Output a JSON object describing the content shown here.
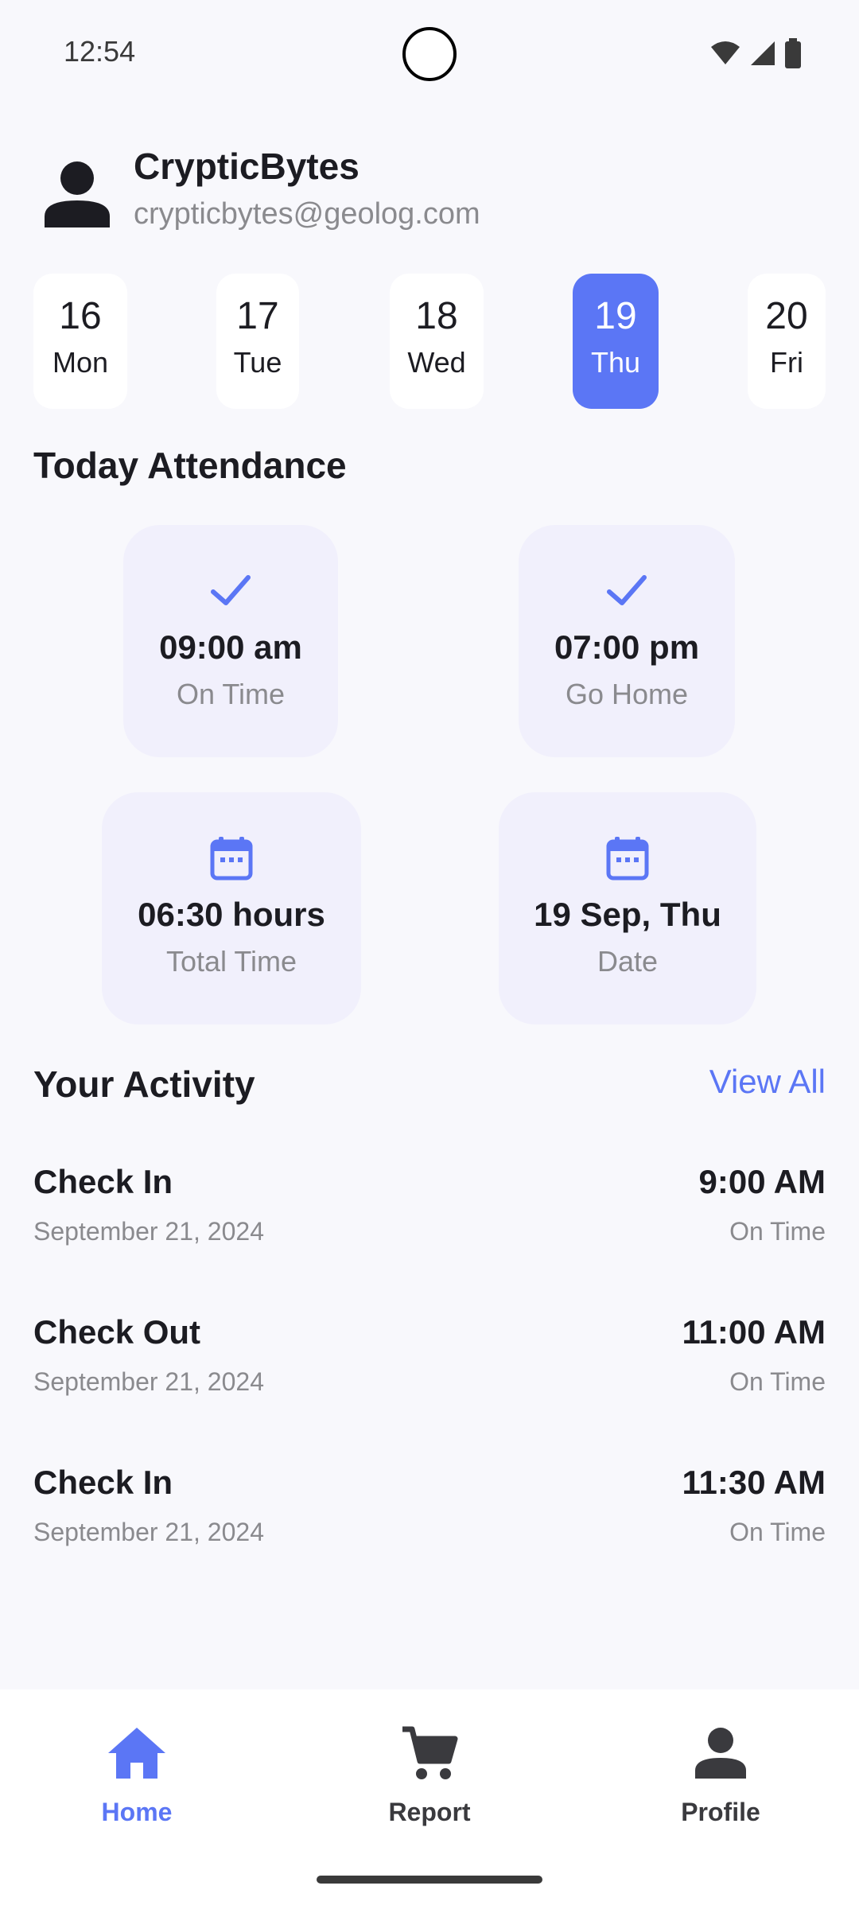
{
  "status_bar": {
    "time": "12:54"
  },
  "profile": {
    "name": "CrypticBytes",
    "email": "crypticbytes@geolog.com"
  },
  "days": [
    {
      "num": "16",
      "weekday": "Mon",
      "active": false
    },
    {
      "num": "17",
      "weekday": "Tue",
      "active": false
    },
    {
      "num": "18",
      "weekday": "Wed",
      "active": false
    },
    {
      "num": "19",
      "weekday": "Thu",
      "active": true
    },
    {
      "num": "20",
      "weekday": "Fri",
      "active": false
    }
  ],
  "attendance": {
    "title": "Today Attendance",
    "cards": [
      {
        "icon": "check-icon",
        "value": "09:00 am",
        "label": "On Time"
      },
      {
        "icon": "check-icon",
        "value": "07:00 pm",
        "label": "Go Home"
      },
      {
        "icon": "calendar-icon",
        "value": "06:30 hours",
        "label": "Total Time"
      },
      {
        "icon": "calendar-icon",
        "value": "19 Sep, Thu",
        "label": "Date"
      }
    ]
  },
  "activity": {
    "title": "Your Activity",
    "view_all_label": "View All",
    "items": [
      {
        "title": "Check In",
        "date": "September 21, 2024",
        "time": "9:00 AM",
        "status": "On Time"
      },
      {
        "title": "Check Out",
        "date": "September 21, 2024",
        "time": "11:00 AM",
        "status": "On Time"
      },
      {
        "title": "Check In",
        "date": "September 21, 2024",
        "time": "11:30 AM",
        "status": "On Time"
      }
    ]
  },
  "nav": {
    "items": [
      {
        "label": "Home",
        "icon": "home-icon",
        "active": true
      },
      {
        "label": "Report",
        "icon": "cart-icon",
        "active": false
      },
      {
        "label": "Profile",
        "icon": "person-icon",
        "active": false
      }
    ]
  },
  "colors": {
    "accent": "#5b76f5",
    "card_background": "#f1f0fc",
    "page_background": "#f8f8fc"
  }
}
